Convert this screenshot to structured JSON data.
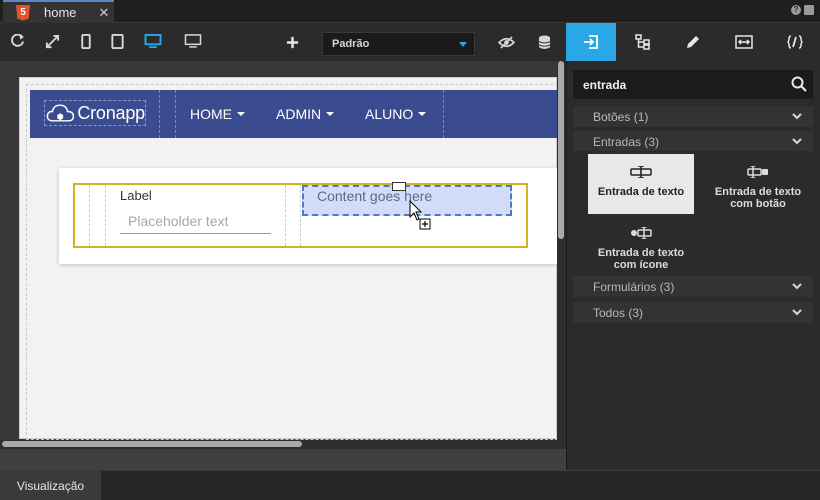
{
  "tab": {
    "title": "home",
    "close": "✕",
    "badge": "5"
  },
  "window": {
    "help": "?"
  },
  "toolbar": {
    "dropdown_value": "Padrão"
  },
  "page": {
    "logo_text": "Cronapp",
    "nav": [
      "HOME",
      "ADMIN",
      "ALUNO"
    ],
    "field_label": "Label",
    "field_placeholder": "Placeholder text",
    "drop_text": "Content goes here"
  },
  "bottom": {
    "tab_label": "Visualização"
  },
  "panel": {
    "search_value": "entrada",
    "categories": [
      {
        "label": "Botões (1)"
      },
      {
        "label": "Entradas (3)"
      },
      {
        "label": "Formulários (3)"
      },
      {
        "label": "Todos (3)"
      }
    ],
    "components": [
      {
        "label": "Entrada de texto"
      },
      {
        "label": "Entrada de texto com botão"
      },
      {
        "label": "Entrada de texto com ícone"
      }
    ]
  },
  "colors": {
    "accent": "#2aa7e6",
    "navbar": "#3b4b8f",
    "row_border": "#d4b320",
    "drop_bg": "#d3dcf8"
  }
}
